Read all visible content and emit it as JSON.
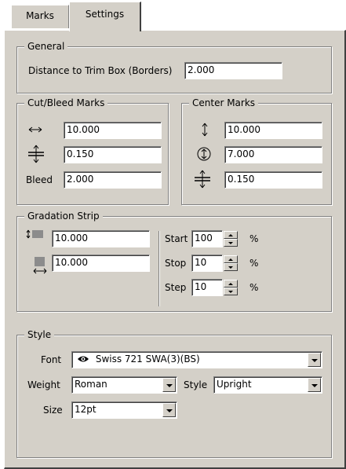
{
  "tabs": {
    "marks": "Marks",
    "settings": "Settings"
  },
  "general": {
    "legend": "General",
    "trim_label": "Distance to Trim Box (Borders)",
    "trim_value": "2.000"
  },
  "cut_bleed": {
    "legend": "Cut/Bleed Marks",
    "length_value": "10.000",
    "width_value": "0.150",
    "bleed_label": "Bleed",
    "bleed_value": "2.000"
  },
  "center_marks": {
    "legend": "Center Marks",
    "length_value": "10.000",
    "size_value": "7.000",
    "width_value": "0.150"
  },
  "gradation": {
    "legend": "Gradation Strip",
    "height_value": "10.000",
    "width_value": "10.000",
    "start_label": "Start",
    "start_value": "100",
    "stop_label": "Stop",
    "stop_value": "10",
    "step_label": "Step",
    "step_value": "10",
    "percent": "%"
  },
  "style": {
    "legend": "Style",
    "font_label": "Font",
    "font_value": "Swiss 721 SWA(3)(BS)",
    "weight_label": "Weight",
    "weight_value": "Roman",
    "style_label": "Style",
    "style_value": "Upright",
    "size_label": "Size",
    "size_value": "12pt"
  },
  "colors": {
    "face": "#d4d0c8",
    "shadow": "#808080",
    "dark": "#404040",
    "gradation_swatch": "#8c8c8c"
  },
  "icons": [
    "horizontal-arrow-icon",
    "cross-width-icon",
    "vertical-arrow-icon",
    "circled-arrow-icon",
    "eye-icon",
    "swatch-height-icon",
    "swatch-width-icon"
  ]
}
